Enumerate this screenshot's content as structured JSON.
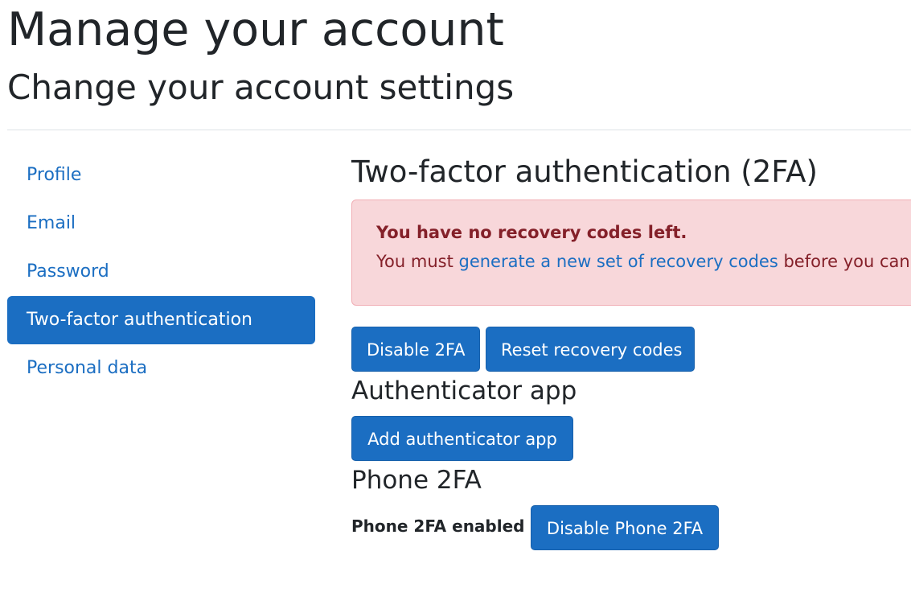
{
  "header": {
    "title": "Manage your account",
    "subtitle": "Change your account settings"
  },
  "sidebar": {
    "items": [
      {
        "label": "Profile",
        "active": false
      },
      {
        "label": "Email",
        "active": false
      },
      {
        "label": "Password",
        "active": false
      },
      {
        "label": "Two-factor authentication",
        "active": true
      },
      {
        "label": "Personal data",
        "active": false
      }
    ]
  },
  "main": {
    "title": "Two-factor authentication (2FA)",
    "alert": {
      "strong_text": "You have no recovery codes left.",
      "text_before_link": "You must ",
      "link_text": "generate a new set of recovery codes",
      "text_after_link": " before you can"
    },
    "actions": {
      "disable_2fa_label": "Disable 2FA",
      "reset_recovery_label": "Reset recovery codes"
    },
    "authenticator": {
      "heading": "Authenticator app",
      "add_button_label": "Add authenticator app"
    },
    "phone": {
      "heading": "Phone 2FA",
      "status_text": "Phone 2FA enabled",
      "disable_button_label": "Disable Phone 2FA"
    }
  },
  "colors": {
    "primary": "#1b6ec2",
    "alert_background": "#f8d7da",
    "alert_text": "#842029",
    "text": "#212529"
  }
}
